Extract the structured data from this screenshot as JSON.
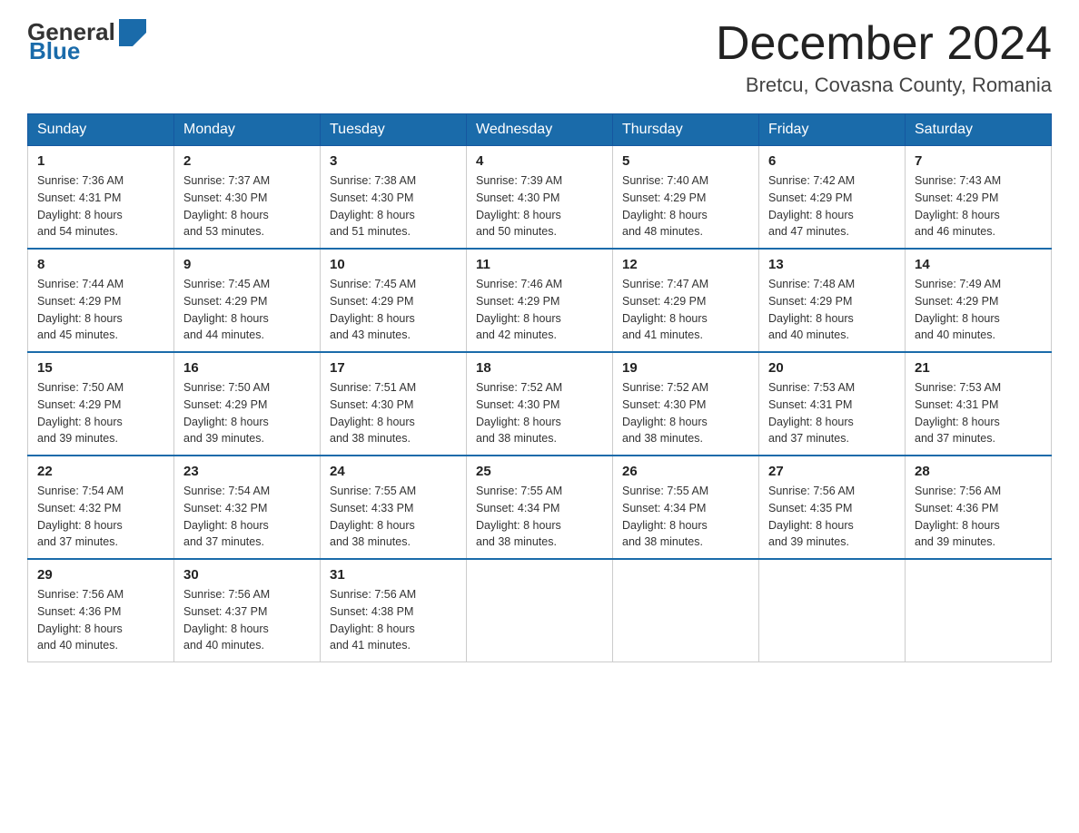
{
  "header": {
    "title": "December 2024",
    "subtitle": "Bretcu, Covasna County, Romania",
    "logo_general": "General",
    "logo_blue": "Blue"
  },
  "calendar": {
    "days_of_week": [
      "Sunday",
      "Monday",
      "Tuesday",
      "Wednesday",
      "Thursday",
      "Friday",
      "Saturday"
    ],
    "weeks": [
      [
        {
          "day": "1",
          "sunrise": "7:36 AM",
          "sunset": "4:31 PM",
          "daylight": "8 hours and 54 minutes."
        },
        {
          "day": "2",
          "sunrise": "7:37 AM",
          "sunset": "4:30 PM",
          "daylight": "8 hours and 53 minutes."
        },
        {
          "day": "3",
          "sunrise": "7:38 AM",
          "sunset": "4:30 PM",
          "daylight": "8 hours and 51 minutes."
        },
        {
          "day": "4",
          "sunrise": "7:39 AM",
          "sunset": "4:30 PM",
          "daylight": "8 hours and 50 minutes."
        },
        {
          "day": "5",
          "sunrise": "7:40 AM",
          "sunset": "4:29 PM",
          "daylight": "8 hours and 48 minutes."
        },
        {
          "day": "6",
          "sunrise": "7:42 AM",
          "sunset": "4:29 PM",
          "daylight": "8 hours and 47 minutes."
        },
        {
          "day": "7",
          "sunrise": "7:43 AM",
          "sunset": "4:29 PM",
          "daylight": "8 hours and 46 minutes."
        }
      ],
      [
        {
          "day": "8",
          "sunrise": "7:44 AM",
          "sunset": "4:29 PM",
          "daylight": "8 hours and 45 minutes."
        },
        {
          "day": "9",
          "sunrise": "7:45 AM",
          "sunset": "4:29 PM",
          "daylight": "8 hours and 44 minutes."
        },
        {
          "day": "10",
          "sunrise": "7:45 AM",
          "sunset": "4:29 PM",
          "daylight": "8 hours and 43 minutes."
        },
        {
          "day": "11",
          "sunrise": "7:46 AM",
          "sunset": "4:29 PM",
          "daylight": "8 hours and 42 minutes."
        },
        {
          "day": "12",
          "sunrise": "7:47 AM",
          "sunset": "4:29 PM",
          "daylight": "8 hours and 41 minutes."
        },
        {
          "day": "13",
          "sunrise": "7:48 AM",
          "sunset": "4:29 PM",
          "daylight": "8 hours and 40 minutes."
        },
        {
          "day": "14",
          "sunrise": "7:49 AM",
          "sunset": "4:29 PM",
          "daylight": "8 hours and 40 minutes."
        }
      ],
      [
        {
          "day": "15",
          "sunrise": "7:50 AM",
          "sunset": "4:29 PM",
          "daylight": "8 hours and 39 minutes."
        },
        {
          "day": "16",
          "sunrise": "7:50 AM",
          "sunset": "4:29 PM",
          "daylight": "8 hours and 39 minutes."
        },
        {
          "day": "17",
          "sunrise": "7:51 AM",
          "sunset": "4:30 PM",
          "daylight": "8 hours and 38 minutes."
        },
        {
          "day": "18",
          "sunrise": "7:52 AM",
          "sunset": "4:30 PM",
          "daylight": "8 hours and 38 minutes."
        },
        {
          "day": "19",
          "sunrise": "7:52 AM",
          "sunset": "4:30 PM",
          "daylight": "8 hours and 38 minutes."
        },
        {
          "day": "20",
          "sunrise": "7:53 AM",
          "sunset": "4:31 PM",
          "daylight": "8 hours and 37 minutes."
        },
        {
          "day": "21",
          "sunrise": "7:53 AM",
          "sunset": "4:31 PM",
          "daylight": "8 hours and 37 minutes."
        }
      ],
      [
        {
          "day": "22",
          "sunrise": "7:54 AM",
          "sunset": "4:32 PM",
          "daylight": "8 hours and 37 minutes."
        },
        {
          "day": "23",
          "sunrise": "7:54 AM",
          "sunset": "4:32 PM",
          "daylight": "8 hours and 37 minutes."
        },
        {
          "day": "24",
          "sunrise": "7:55 AM",
          "sunset": "4:33 PM",
          "daylight": "8 hours and 38 minutes."
        },
        {
          "day": "25",
          "sunrise": "7:55 AM",
          "sunset": "4:34 PM",
          "daylight": "8 hours and 38 minutes."
        },
        {
          "day": "26",
          "sunrise": "7:55 AM",
          "sunset": "4:34 PM",
          "daylight": "8 hours and 38 minutes."
        },
        {
          "day": "27",
          "sunrise": "7:56 AM",
          "sunset": "4:35 PM",
          "daylight": "8 hours and 39 minutes."
        },
        {
          "day": "28",
          "sunrise": "7:56 AM",
          "sunset": "4:36 PM",
          "daylight": "8 hours and 39 minutes."
        }
      ],
      [
        {
          "day": "29",
          "sunrise": "7:56 AM",
          "sunset": "4:36 PM",
          "daylight": "8 hours and 40 minutes."
        },
        {
          "day": "30",
          "sunrise": "7:56 AM",
          "sunset": "4:37 PM",
          "daylight": "8 hours and 40 minutes."
        },
        {
          "day": "31",
          "sunrise": "7:56 AM",
          "sunset": "4:38 PM",
          "daylight": "8 hours and 41 minutes."
        },
        null,
        null,
        null,
        null
      ]
    ],
    "labels": {
      "sunrise": "Sunrise:",
      "sunset": "Sunset:",
      "daylight": "Daylight:"
    }
  }
}
